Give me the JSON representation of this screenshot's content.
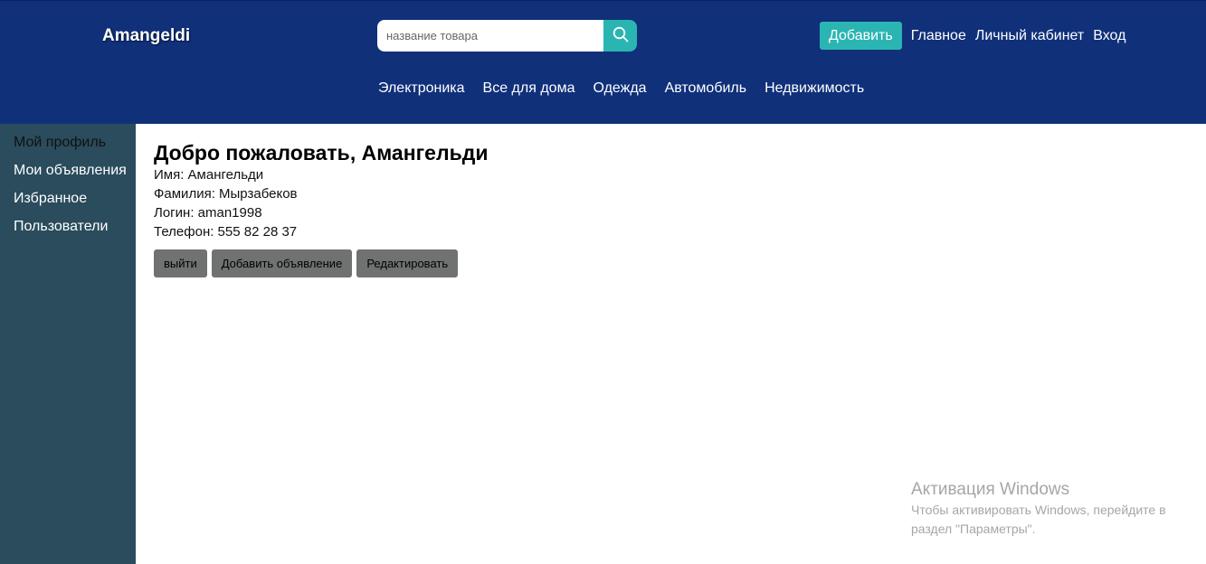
{
  "header": {
    "brand": "Amangeldi",
    "search": {
      "placeholder": "название товара",
      "value": "",
      "icon": "search-icon"
    },
    "top_nav": {
      "add_label": "Добавить",
      "links": [
        "Главное",
        "Личный кабинет",
        "Вход"
      ]
    },
    "categories": [
      "Электроника",
      "Все для дома",
      "Одежда",
      "Автомобиль",
      "Недвижимость"
    ]
  },
  "sidebar": {
    "items": [
      {
        "label": "Мой профиль",
        "active": true
      },
      {
        "label": "Мои объявления",
        "active": false
      },
      {
        "label": "Избранное",
        "active": false
      },
      {
        "label": "Пользователи",
        "active": false
      }
    ]
  },
  "profile": {
    "welcome": "Добро пожаловать, Амангельди",
    "first_name": "Имя: Амангельди",
    "last_name": "Фамилия: Мырзабеков",
    "login": "Логин: aman1998",
    "phone": "Телефон: 555 82 28 37",
    "buttons": {
      "logout": "выйти",
      "add_ad": "Добавить объявление",
      "edit": "Редактировать"
    }
  },
  "watermark": {
    "title": "Активация Windows",
    "text": "Чтобы активировать Windows, перейдите в раздел \"Параметры\"."
  },
  "colors": {
    "header_bg": "#10307a",
    "accent": "#2bb5b2",
    "sidebar_bg": "#2a4c5c",
    "button_gray": "#6f7270"
  }
}
